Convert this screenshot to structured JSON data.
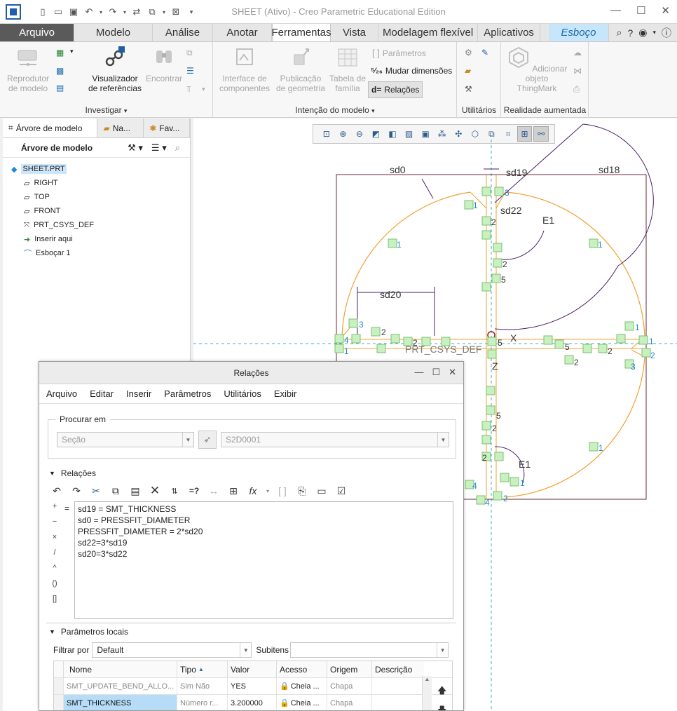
{
  "window": {
    "title": "SHEET (Ativo) - Creo Parametric Educational Edition"
  },
  "tabs": [
    {
      "label": "Arquivo"
    },
    {
      "label": "Modelo"
    },
    {
      "label": "Análise"
    },
    {
      "label": "Anotar"
    },
    {
      "label": "Ferramentas"
    },
    {
      "label": "Vista"
    },
    {
      "label": "Modelagem flexível"
    },
    {
      "label": "Aplicativos"
    },
    {
      "label": "Esboço"
    }
  ],
  "ribbon": {
    "investigar": {
      "label": "Investigar",
      "reprodutor": "Reprodutor\nde modelo",
      "visualizador": "Visualizador\nde referências",
      "encontrar": "Encontrar"
    },
    "intencao": {
      "label": "Intenção do modelo",
      "interface": "Interface de\ncomponentes",
      "publicacao": "Publicação\nde geometria",
      "tabela": "Tabela de\nfamília",
      "parametros": "Parâmetros",
      "mudar": "Mudar dimensões",
      "relacoes": "Relações"
    },
    "utilitarios": {
      "label": "Utilitários"
    },
    "realidade": {
      "label": "Realidade aumentada",
      "adicionar": "Adicionar objeto\nThingMark"
    }
  },
  "left_panel": {
    "tabs": [
      {
        "label": "Árvore de modelo"
      },
      {
        "label": "Na..."
      },
      {
        "label": "Fav..."
      }
    ],
    "header": "Árvore de modelo",
    "tree": [
      {
        "label": "SHEET.PRT",
        "icon": "part-icon"
      },
      {
        "label": "RIGHT",
        "icon": "datum-plane-icon"
      },
      {
        "label": "TOP",
        "icon": "datum-plane-icon"
      },
      {
        "label": "FRONT",
        "icon": "datum-plane-icon"
      },
      {
        "label": "PRT_CSYS_DEF",
        "icon": "csys-icon"
      },
      {
        "label": "Inserir aqui",
        "icon": "insert-arrow-icon"
      },
      {
        "label": "Esboçar 1",
        "icon": "sketch-icon"
      }
    ]
  },
  "sketch": {
    "dims": [
      "sd0",
      "sd19",
      "sd18",
      "sd22",
      "E1",
      "sd20",
      "PRT_CSYS_DEF",
      "X",
      "Z",
      "E1"
    ],
    "nums": [
      "1",
      "2",
      "3",
      "4",
      "5"
    ]
  },
  "dialog": {
    "title": "Relações",
    "menu": [
      "Arquivo",
      "Editar",
      "Inserir",
      "Parâmetros",
      "Utilitários",
      "Exibir"
    ],
    "search": {
      "legend": "Procurar em",
      "type": "Seção",
      "value": "S2D0001"
    },
    "relations_header": "Relações",
    "operators": [
      "+",
      "−",
      "×",
      "/",
      "^",
      "()",
      "[]"
    ],
    "equals": "=",
    "relations": [
      "sd19 = SMT_THICKNESS",
      "sd0 = PRESSFIT_DIAMETER",
      "PRESSFIT_DIAMETER = 2*sd20",
      "sd22=3*sd19",
      "sd20=3*sd22"
    ],
    "params_header": "Parâmetros locais",
    "filter_label": "Filtrar por",
    "filter_value": "Default",
    "subitems_label": "Subitens",
    "table": {
      "columns": [
        "Nome",
        "Tipo",
        "Valor",
        "Acesso",
        "Origem",
        "Descrição"
      ],
      "rows": [
        {
          "name": "SMT_UPDATE_BEND_ALLO...",
          "type": "Sim Não",
          "value": "YES",
          "access": "Cheia ...",
          "origin": "Chapa"
        },
        {
          "name": "SMT_THICKNESS",
          "type": "Número r...",
          "value": "3.200000",
          "access": "Cheia ...",
          "origin": "Chapa"
        }
      ]
    }
  }
}
